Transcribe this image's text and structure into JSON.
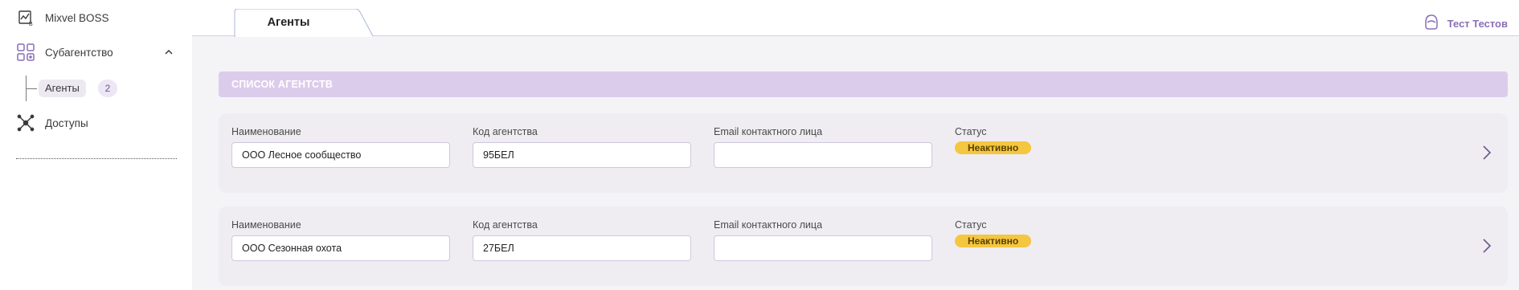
{
  "sidebar": {
    "app_name": "Mixvel BOSS",
    "subagency_label": "Субагентство",
    "agents_label": "Агенты",
    "agents_count": "2",
    "access_label": "Доступы"
  },
  "header": {
    "active_tab": "Агенты",
    "user_name": "Тест Тестов"
  },
  "section": {
    "title": "СПИСОК АГЕНТСТВ"
  },
  "field_labels": {
    "name": "Наименование",
    "code": "Код агентства",
    "email": "Email контактного лица",
    "status": "Статус"
  },
  "agents": [
    {
      "name": "ООО Лесное сообщество",
      "code": "95БЕЛ",
      "email": "",
      "status": "Неактивно"
    },
    {
      "name": "ООО Сезонная охота",
      "code": "27БЕЛ",
      "email": "",
      "status": "Неактивно"
    }
  ],
  "colors": {
    "accent": "#8a6fb5",
    "section_header": "#dccceb",
    "status_inactive": "#f5c640"
  }
}
